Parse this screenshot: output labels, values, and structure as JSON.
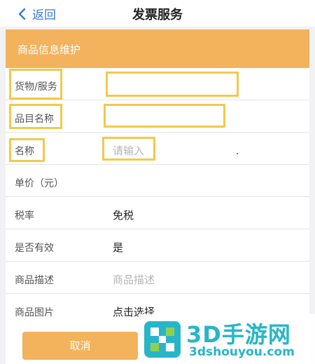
{
  "nav": {
    "back_label": "返回",
    "title": "发票服务"
  },
  "section": {
    "banner_title": "商品信息维护"
  },
  "form": {
    "goods_service_label": "货物/服务",
    "category_label": "品目名称",
    "name_label": "名称",
    "name_placeholder": "请输入",
    "unit_price_label": "单价（元）",
    "tax_rate_label": "税率",
    "tax_rate_value": "免税",
    "valid_label": "是否有效",
    "valid_value": "是",
    "desc_label": "商品描述",
    "desc_placeholder": "商品描述",
    "image_label": "商品图片",
    "image_value": "点击选择"
  },
  "buttons": {
    "cancel_label": "取消"
  },
  "watermark": {
    "brand": "3D手游网",
    "url": "3dshouyou.com"
  },
  "colors": {
    "accent": "#f2b35c",
    "link": "#2f7ee0",
    "highlight": "#f2c94c",
    "watermark": "#28b5c8"
  }
}
